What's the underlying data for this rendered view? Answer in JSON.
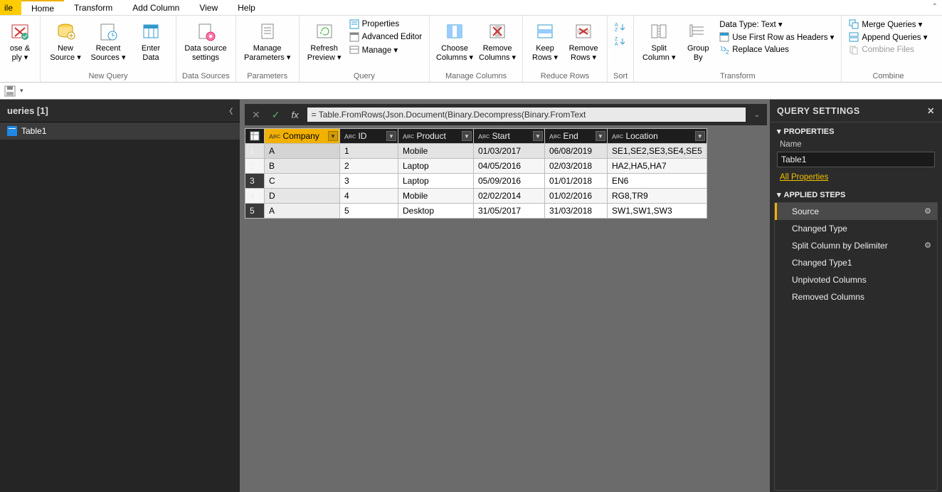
{
  "tabs": {
    "file": "ile",
    "home": "Home",
    "transform": "Transform",
    "addcol": "Add Column",
    "view": "View",
    "help": "Help"
  },
  "ribbon": {
    "close": {
      "line1": "ose &",
      "line2": "ply ▾",
      "group": ""
    },
    "newquery": {
      "new": "New",
      "source": "Source ▾",
      "recent": "Recent",
      "sources": "Sources ▾",
      "enter": "Enter",
      "data": "Data",
      "group": "New Query"
    },
    "datasources": {
      "line1": "Data source",
      "line2": "settings",
      "group": "Data Sources"
    },
    "parameters": {
      "line1": "Manage",
      "line2": "Parameters ▾",
      "group": "Parameters"
    },
    "query": {
      "refresh1": "Refresh",
      "refresh2": "Preview ▾",
      "props": "Properties",
      "adv": "Advanced Editor",
      "manage": "Manage ▾",
      "group": "Query"
    },
    "managecols": {
      "choose1": "Choose",
      "choose2": "Columns ▾",
      "remove1": "Remove",
      "remove2": "Columns ▾",
      "group": "Manage Columns"
    },
    "reducerows": {
      "keep1": "Keep",
      "keep2": "Rows ▾",
      "remove1": "Remove",
      "remove2": "Rows ▾",
      "group": "Reduce Rows"
    },
    "sort": {
      "group": "Sort"
    },
    "transform": {
      "split1": "Split",
      "split2": "Column ▾",
      "group1": "Group",
      "group2": "By",
      "datatype": "Data Type: Text ▾",
      "firstrow": "Use First Row as Headers ▾",
      "replace": "Replace Values",
      "group": "Transform"
    },
    "combine": {
      "merge": "Merge Queries ▾",
      "append": "Append Queries ▾",
      "combinef": "Combine Files",
      "group": "Combine"
    }
  },
  "queriesPane": {
    "title": "ueries [1]",
    "item": "Table1"
  },
  "formula": "= Table.FromRows(Json.Document(Binary.Decompress(Binary.FromText",
  "columns": [
    "Company",
    "ID",
    "Product",
    "Start",
    "End",
    "Location"
  ],
  "rows": [
    {
      "n": "1",
      "Company": "A",
      "ID": "1",
      "Product": "Mobile",
      "Start": "01/03/2017",
      "End": "06/08/2019",
      "Location": "SE1,SE2,SE3,SE4,SE5"
    },
    {
      "n": "2",
      "Company": "B",
      "ID": "2",
      "Product": "Laptop",
      "Start": "04/05/2016",
      "End": "02/03/2018",
      "Location": "HA2,HA5,HA7"
    },
    {
      "n": "3",
      "Company": "C",
      "ID": "3",
      "Product": "Laptop",
      "Start": "05/09/2016",
      "End": "01/01/2018",
      "Location": "EN6"
    },
    {
      "n": "4",
      "Company": "D",
      "ID": "4",
      "Product": "Mobile",
      "Start": "02/02/2014",
      "End": "01/02/2016",
      "Location": "RG8,TR9"
    },
    {
      "n": "5",
      "Company": "A",
      "ID": "5",
      "Product": "Desktop",
      "Start": "31/05/2017",
      "End": "31/03/2018",
      "Location": "SW1,SW1,SW3"
    }
  ],
  "settings": {
    "title": "QUERY SETTINGS",
    "properties": "PROPERTIES",
    "nameLabel": "Name",
    "name": "Table1",
    "allProps": "All Properties",
    "stepsTitle": "APPLIED STEPS",
    "steps": [
      "Source",
      "Changed Type",
      "Split Column by Delimiter",
      "Changed Type1",
      "Unpivoted Columns",
      "Removed Columns"
    ]
  }
}
